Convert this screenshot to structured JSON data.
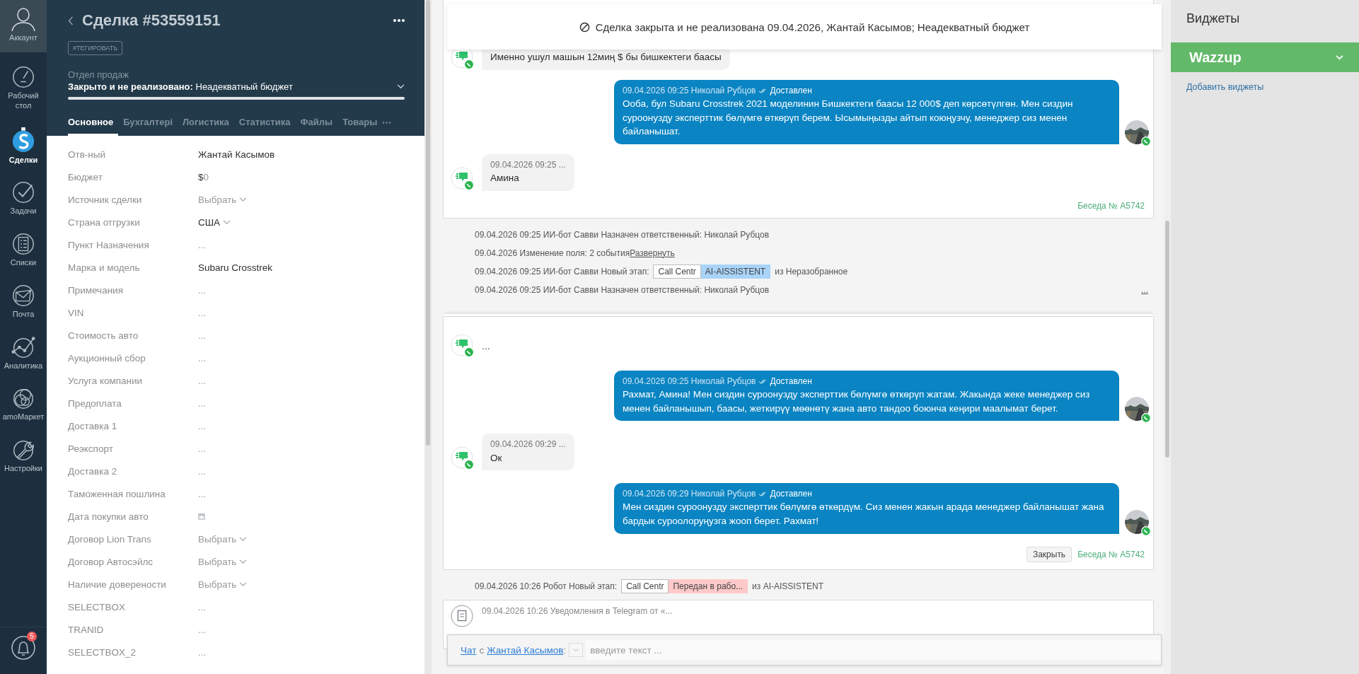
{
  "nav": {
    "items": [
      {
        "kind": "account",
        "label": "Аккаунт",
        "selected": false
      },
      {
        "kind": "dashboard",
        "label": "Рабочий стол",
        "selected": false
      },
      {
        "kind": "deals",
        "label": "Сделки",
        "selected": true
      },
      {
        "kind": "tasks",
        "label": "Задачи",
        "selected": false
      },
      {
        "kind": "lists",
        "label": "Списки",
        "selected": false
      },
      {
        "kind": "mail",
        "label": "Почта",
        "selected": false
      },
      {
        "kind": "analytics",
        "label": "Аналитика",
        "selected": false
      },
      {
        "kind": "market",
        "label": "amoМаркет",
        "selected": false
      },
      {
        "kind": "settings",
        "label": "Настройки",
        "selected": false
      }
    ],
    "notifications": {
      "badge": "5"
    }
  },
  "deal": {
    "title": "Сделка #53559151",
    "tag_button": "#ТЕГИРОВАТЬ",
    "pipeline": "Отдел продаж",
    "status": "Закрыто и не реализовано:",
    "reason": "Неадекватный бюджет",
    "level": 1,
    "tabs": [
      {
        "label": "Основное",
        "selected": true
      },
      {
        "label": "Бухгалтері",
        "selected": false
      },
      {
        "label": "Логистика",
        "selected": false
      },
      {
        "label": "Статистика",
        "selected": false
      },
      {
        "label": "Файлы",
        "selected": false
      },
      {
        "label": "Товары",
        "selected": false
      }
    ],
    "fields": [
      {
        "label": "Отв-ный",
        "kind": "text",
        "value": "Жантай Касымов"
      },
      {
        "label": "Бюджет",
        "kind": "money",
        "prefix": "$",
        "value": "0"
      },
      {
        "label": "Источник сделки",
        "kind": "choose",
        "placeholder": "Выбрать"
      },
      {
        "label": "Страна отгрузки",
        "kind": "select",
        "value": "США"
      },
      {
        "label": "Пункт Назначения",
        "kind": "empty",
        "placeholder": "..."
      },
      {
        "label": "Марка и модель",
        "kind": "text",
        "value": "Subaru Crosstrek"
      },
      {
        "label": "Примечания",
        "kind": "empty",
        "placeholder": "..."
      },
      {
        "label": "VIN",
        "kind": "empty",
        "placeholder": "..."
      },
      {
        "label": "Стоимость авто",
        "kind": "empty",
        "placeholder": "..."
      },
      {
        "label": "Аукционный сбор",
        "kind": "empty",
        "placeholder": "..."
      },
      {
        "label": "Услуга компании",
        "kind": "empty",
        "placeholder": "..."
      },
      {
        "label": "Предоплата",
        "kind": "empty",
        "placeholder": "..."
      },
      {
        "label": "Доставка 1",
        "kind": "empty",
        "placeholder": "..."
      },
      {
        "label": "Реэкспорт",
        "kind": "empty",
        "placeholder": "..."
      },
      {
        "label": "Доставка 2",
        "kind": "empty",
        "placeholder": "..."
      },
      {
        "label": "Таможенная пошлина",
        "kind": "empty",
        "placeholder": "..."
      },
      {
        "label": "Дата покупки авто",
        "kind": "date"
      },
      {
        "label": "Договор Lion Trans",
        "kind": "choose",
        "placeholder": "Выбрать"
      },
      {
        "label": "Договор Автосэйлс",
        "kind": "choose",
        "placeholder": "Выбрать"
      },
      {
        "label": "Наличие доверености",
        "kind": "choose",
        "placeholder": "Выбрать"
      },
      {
        "label": "SELECTBOX",
        "kind": "empty",
        "placeholder": "..."
      },
      {
        "label": "TRANID",
        "kind": "empty",
        "placeholder": "..."
      },
      {
        "label": "SELECTBOX_2",
        "kind": "empty",
        "placeholder": "..."
      }
    ]
  },
  "feed": {
    "banner": "Сделка закрыта и не реализована 09.04.2026, Жантай Касымов; Неадекватный бюджет",
    "items": [
      {
        "kind": "chat",
        "stacked": false,
        "messages": [
          {
            "kind": "incoming",
            "text": "Именно ушул машын 12миң $ бы бишкектеги баасы"
          },
          {
            "kind": "outgoing",
            "meta": "09.04.2026 09:25 Николай Рубцов",
            "status": "Доставлен",
            "text": "Ооба, бул Subaru Crosstrek 2021 моделинин Бишкектеги баасы 12 000$ деп көрсөтүлгөн. Мен сиздин суроонузду эксперттик бөлүмгө өткөрүп берем. Ысымыңызды айтып коюңузчу, менеджер сиз менен байланышат."
          },
          {
            "kind": "incoming",
            "meta": "09.04.2026 09:25 ...",
            "text": "Амина"
          }
        ],
        "link": "Беседа № A5742"
      },
      {
        "kind": "event",
        "text": "09.04.2026 09:25 ИИ-бот Савви Назначен ответственный: Николай Рубцов"
      },
      {
        "kind": "event",
        "text": "09.04.2026 Изменение поля: 2 события",
        "link": "Развернуть"
      },
      {
        "kind": "stage",
        "text": "09.04.2026 09:25 ИИ-бот Савви Новый этап:",
        "stages": [
          {
            "label": "Call Centr",
            "color": "#ffffff"
          },
          {
            "label": "AI-AISSISTENT",
            "color": "#a9d3f8"
          }
        ],
        "after": "из Неразобранное"
      },
      {
        "kind": "event",
        "text": "09.04.2026 09:25 ИИ-бот Савви Назначен ответственный: Николай Рубцов",
        "more": "..."
      },
      {
        "kind": "chat",
        "stacked": true,
        "messages": [
          {
            "kind": "plain",
            "text": "..."
          },
          {
            "kind": "outgoing",
            "meta": "09.04.2026 09:25 Николай Рубцов",
            "status": "Доставлен",
            "text": "Рахмат, Амина! Мен сиздин суроонузду эксперттик бөлүмгө өткөрүп жатам. Жакында жеке менеджер сиз менен байланышып, баасы, жеткирүү мөөнөтү жана авто тандоо боюнча кеңири маалымат берет."
          },
          {
            "kind": "incoming",
            "meta": "09.04.2026 09:29 ...",
            "text": "Ок"
          },
          {
            "kind": "outgoing",
            "meta": "09.04.2026 09:29 Николай Рубцов",
            "status": "Доставлен",
            "text": "Мен сиздин суроонузду эксперттик бөлүмгө өткөрдүм. Сиз менен жакын арада менеджер байланышат жана бардык суроолоруңузга жооп берет. Рахмат!"
          }
        ],
        "button": "Закрыть",
        "link": "Беседа № A5742"
      },
      {
        "kind": "stage",
        "text": "09.04.2026 10:26 Робот Новый этап:",
        "stages": [
          {
            "label": "Call Centr",
            "color": "#ffffff"
          },
          {
            "label": "Передан в рабо...",
            "color": "#ffc9c9"
          }
        ],
        "after": "из AI-AISSISTENT"
      },
      {
        "kind": "note",
        "text": "09.04.2026 10:26 Уведомления в Telegram от «..."
      }
    ],
    "input": {
      "chat_link": "Чат",
      "with": "с",
      "contact_link": "Жантай Касымов",
      "colon": ":",
      "placeholder": "введите текст ..."
    }
  },
  "widgets": {
    "title": "Виджеты",
    "items": [
      {
        "label": "Wazzup",
        "expanded": false
      }
    ],
    "add_link": "Добавить виджеты"
  }
}
